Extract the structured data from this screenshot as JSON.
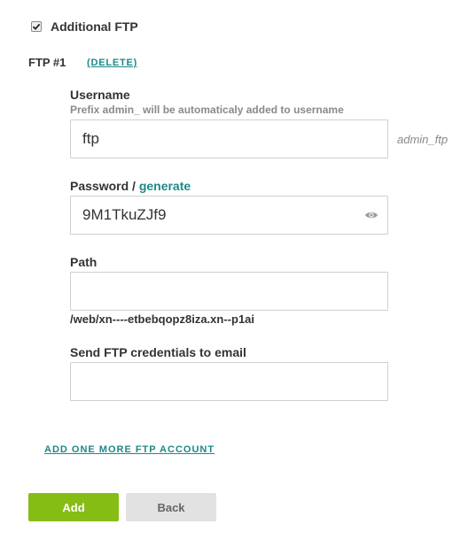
{
  "additional_ftp": {
    "label": "Additional FTP",
    "checked": true
  },
  "ftp_account": {
    "title": "FTP #1",
    "delete_label": "(DELETE)",
    "username": {
      "label": "Username",
      "hint": "Prefix admin_ will be automaticaly added to username",
      "value": "ftp",
      "suffix": "admin_ftp"
    },
    "password": {
      "label": "Password",
      "separator": " / ",
      "generate_label": "generate",
      "value": "9M1TkuZJf9"
    },
    "path": {
      "label": "Path",
      "value": "",
      "resolved": "/web/xn----etbebqopz8iza.xn--p1ai"
    },
    "email": {
      "label": "Send FTP credentials to email",
      "value": ""
    }
  },
  "add_more_label": "ADD ONE MORE FTP ACCOUNT",
  "buttons": {
    "add": "Add",
    "back": "Back"
  },
  "colors": {
    "accent": "#1c8a86",
    "primary_button": "#86bd14",
    "secondary_button": "#e2e2e2"
  }
}
